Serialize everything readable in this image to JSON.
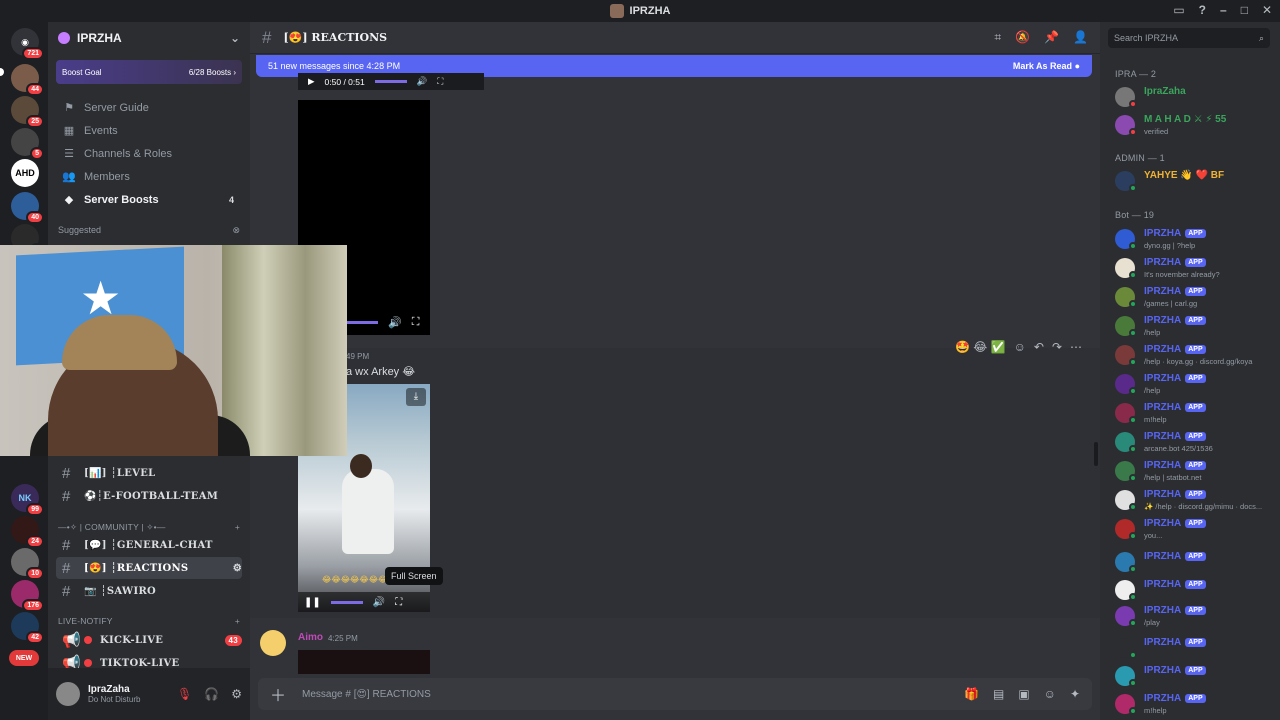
{
  "window": {
    "title": "IPRZHA"
  },
  "guilds": {
    "badges": [
      "721",
      "44",
      "25",
      "5",
      "40",
      "1",
      "99",
      "24",
      "10",
      "176",
      "42",
      "42",
      "418"
    ],
    "ahd_label": "AHD",
    "nk_label": "NK",
    "new_label": "NEW"
  },
  "server": {
    "name": "IPRZHA",
    "boost_goal_label": "Boost Goal",
    "boost_goal_count": "6/28 Boosts",
    "nav": [
      {
        "label": "Server Guide",
        "icon": "signpost-icon"
      },
      {
        "label": "Events",
        "icon": "calendar-icon"
      },
      {
        "label": "Channels & Roles",
        "icon": "list-icon"
      },
      {
        "label": "Members",
        "icon": "people-icon"
      },
      {
        "label": "Server Boosts",
        "icon": "boost-icon",
        "count": "4"
      }
    ],
    "suggested_label": "Suggested",
    "channels_top": [
      {
        "name": "[📊] ┆LEVEL"
      },
      {
        "name": "⚽️┆E-FOOTBALL-TEAM"
      }
    ],
    "community_category": "—•✧ | COMMUNITY | ✧•—",
    "channels_community": [
      {
        "name": "[💬] ┆GENERAL-CHAT"
      },
      {
        "name": "[😍] ┆REACTIONS"
      },
      {
        "name": "📷 ┆SAWIRO"
      }
    ],
    "live_category": "LIVE-NOTIFY",
    "channels_live": [
      {
        "name": "KICK-LIVE",
        "count": "43"
      },
      {
        "name": "TIKTOK-LIVE"
      }
    ]
  },
  "user": {
    "name": "IpraZaha",
    "status": "Do Not Disturb"
  },
  "channel": {
    "name": "[😍] REACTIONS",
    "new_messages": "51 new messages since 4:28 PM",
    "mark_as_read": "Mark As Read",
    "video1_time": "0:50 / 0:51",
    "msg_timestamp_fragment": "49 PM",
    "msg_text_fragment": "a wx Arkey 😂",
    "reaction_emojis": "🤩 😂 ✅",
    "video2_emojis": "😂😂😂😂😂😂😂",
    "tooltip": "Full Screen",
    "next_author": "Aimo",
    "next_timestamp": "4:25 PM",
    "composer_placeholder": "Message # [😍] REACTIONS"
  },
  "members_panel": {
    "search_placeholder": "Search IPRZHA",
    "groups": {
      "ipra": "IPRA — 2",
      "admin": "ADMIN — 1",
      "bot": "Bot — 19"
    },
    "ipra_members": [
      {
        "name": "IpraZaha",
        "color": "#3ba55c"
      },
      {
        "name": "M A H A D ⚔ ⚡ 55",
        "sub": "verified",
        "color": "#3ba55c"
      }
    ],
    "admin_members": [
      {
        "name": "YAHYE 👋 ❤️ BF",
        "color": "#f0b232"
      }
    ],
    "app_badge": "APP",
    "bot_name_placeholder": "IPRZHA",
    "bots": [
      {
        "sub": "dyno.gg | ?help"
      },
      {
        "sub": "It's november already?"
      },
      {
        "sub": "/games | carl.gg"
      },
      {
        "sub": "/help"
      },
      {
        "sub": "/help · koya.gg · discord.gg/koya"
      },
      {
        "sub": "/help"
      },
      {
        "sub": "m!help"
      },
      {
        "sub": "arcane.bot 425/1536"
      },
      {
        "sub": "/help | statbot.net"
      },
      {
        "sub": "✨ /help · discord.gg/mimu · docs..."
      },
      {
        "sub": "you..."
      },
      {
        "sub": ""
      },
      {
        "sub": ""
      },
      {
        "sub": "/play"
      },
      {
        "sub": ""
      },
      {
        "sub": ""
      },
      {
        "sub": "m!help"
      }
    ]
  }
}
